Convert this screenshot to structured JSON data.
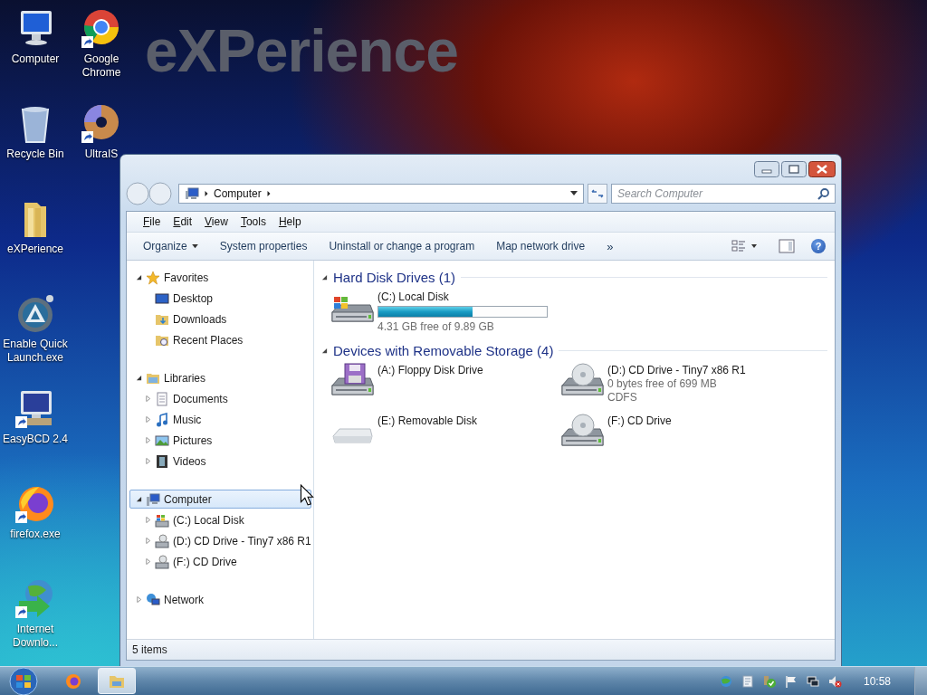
{
  "wallpaper_text": "eXPerience",
  "desktop_icons": [
    {
      "label": "Computer",
      "kind": "computer",
      "shortcut": false
    },
    {
      "label": "Google Chrome",
      "kind": "chrome",
      "shortcut": true
    },
    {
      "label": "Recycle Bin",
      "kind": "bin",
      "shortcut": false
    },
    {
      "label": "UltraIS",
      "kind": "disc",
      "shortcut": true
    },
    {
      "label": "eXPerience",
      "kind": "folder",
      "shortcut": false
    },
    {
      "label": "Enable Quick Launch.exe",
      "kind": "quicklaunch",
      "shortcut": false
    },
    {
      "label": "EasyBCD 2.4",
      "kind": "easybcd",
      "shortcut": true
    },
    {
      "label": "firefox.exe",
      "kind": "firefox",
      "shortcut": true
    },
    {
      "label": "Internet Downlo...",
      "kind": "idm",
      "shortcut": true
    }
  ],
  "window": {
    "address": {
      "crumbs": [
        "Computer"
      ]
    },
    "search": {
      "placeholder": "Search Computer"
    },
    "menu": [
      {
        "key": "F",
        "rest": "ile"
      },
      {
        "key": "E",
        "rest": "dit"
      },
      {
        "key": "V",
        "rest": "iew"
      },
      {
        "key": "T",
        "rest": "ools"
      },
      {
        "key": "H",
        "rest": "elp"
      }
    ],
    "commands": [
      {
        "label": "Organize",
        "kind": "command",
        "dropdown": true
      },
      {
        "label": "System properties",
        "kind": "command",
        "dropdown": false
      },
      {
        "label": "Uninstall or change a program",
        "kind": "command",
        "dropdown": false
      },
      {
        "label": "Map network drive",
        "kind": "command",
        "dropdown": false
      },
      {
        "label": "»",
        "kind": "overflow"
      }
    ],
    "help": "?",
    "navigation": [
      {
        "label": "Favorites",
        "kind": "star",
        "expanded": true,
        "selected": false,
        "children": [
          {
            "label": "Desktop",
            "kind": "desktop",
            "selected": false
          },
          {
            "label": "Downloads",
            "kind": "downloads",
            "selected": false
          },
          {
            "label": "Recent Places",
            "kind": "recent",
            "selected": false
          }
        ]
      },
      {
        "label": "Libraries",
        "kind": "library",
        "expanded": true,
        "selected": false,
        "children": [
          {
            "label": "Documents",
            "kind": "documents",
            "expanded": false,
            "selected": false
          },
          {
            "label": "Music",
            "kind": "music",
            "expanded": false,
            "selected": false
          },
          {
            "label": "Pictures",
            "kind": "pictures",
            "expanded": false,
            "selected": false
          },
          {
            "label": "Videos",
            "kind": "videos",
            "expanded": false,
            "selected": false
          }
        ]
      },
      {
        "label": "Computer",
        "kind": "computer",
        "expanded": true,
        "selected": true,
        "children": [
          {
            "label": "(C:) Local Disk",
            "kind": "hdd",
            "expanded": false,
            "selected": false
          },
          {
            "label": "(D:) CD Drive - Tiny7 x86 R1",
            "kind": "cd",
            "expanded": false,
            "selected": false
          },
          {
            "label": "(F:) CD Drive",
            "kind": "cd",
            "expanded": false,
            "selected": false
          }
        ]
      },
      {
        "label": "Network",
        "kind": "network",
        "expanded": false,
        "selected": false
      }
    ],
    "groups": [
      {
        "title": "Hard Disk Drives (1)",
        "expanded": true,
        "items": [
          {
            "name": "(C:) Local Disk",
            "kind": "hdd",
            "level": 0.56,
            "details": [
              "4.31 GB free of 9.89 GB"
            ]
          }
        ]
      },
      {
        "title": "Devices with Removable Storage (4)",
        "expanded": true,
        "items": [
          {
            "name": "(A:) Floppy Disk Drive",
            "kind": "floppy"
          },
          {
            "name": "(D:) CD Drive - Tiny7 x86 R1",
            "kind": "cd",
            "details": [
              "0 bytes free of 699 MB",
              "CDFS"
            ]
          },
          {
            "name": "(E:) Removable Disk",
            "kind": "removable"
          },
          {
            "name": "(F:) CD Drive",
            "kind": "cd"
          }
        ]
      }
    ],
    "status": "5 items"
  },
  "taskbar": {
    "buttons": [
      {
        "kind": "firefox",
        "selected": false
      },
      {
        "kind": "explorer",
        "selected": true
      }
    ],
    "clock": "10:58"
  }
}
